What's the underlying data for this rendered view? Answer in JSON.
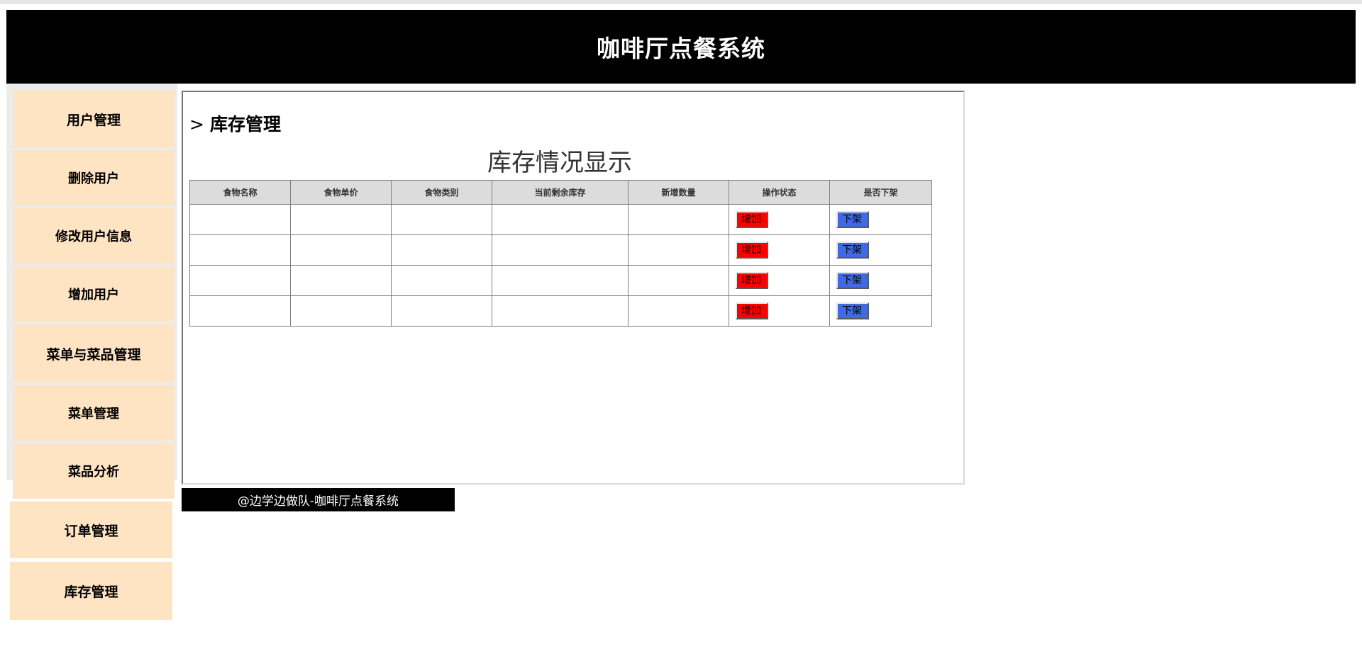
{
  "header": {
    "title": "咖啡厅点餐系统"
  },
  "sidebar": {
    "items": [
      {
        "label": "用户管理"
      },
      {
        "label": "删除用户"
      },
      {
        "label": "修改用户信息"
      },
      {
        "label": "增加用户"
      },
      {
        "label": "菜单与菜品管理"
      },
      {
        "label": "菜单管理"
      },
      {
        "label": "菜品分析"
      },
      {
        "label": "订单管理"
      },
      {
        "label": "库存管理"
      }
    ]
  },
  "main": {
    "breadcrumb_sep": ">",
    "breadcrumb": "库存管理",
    "table_title": "库存情况显示",
    "columns": [
      "食物名称",
      "食物单价",
      "食物类别",
      "当前剩余库存",
      "新增数量",
      "操作状态",
      "是否下架"
    ],
    "rows": [
      {
        "name": "",
        "price": "",
        "category": "",
        "stock": "",
        "add_qty": "",
        "add_label": "增加",
        "off_label": "下架"
      },
      {
        "name": "",
        "price": "",
        "category": "",
        "stock": "",
        "add_qty": "",
        "add_label": "增加",
        "off_label": "下架"
      },
      {
        "name": "",
        "price": "",
        "category": "",
        "stock": "",
        "add_qty": "",
        "add_label": "增加",
        "off_label": "下架"
      },
      {
        "name": "",
        "price": "",
        "category": "",
        "stock": "",
        "add_qty": "",
        "add_label": "增加",
        "off_label": "下架"
      }
    ]
  },
  "footer": {
    "text": "@边学边做队-咖啡厅点餐系统"
  },
  "colors": {
    "header_bg": "#000000",
    "nav_bg": "#ffe4c4",
    "add_button": "#ff0000",
    "off_button": "#4169e1"
  }
}
